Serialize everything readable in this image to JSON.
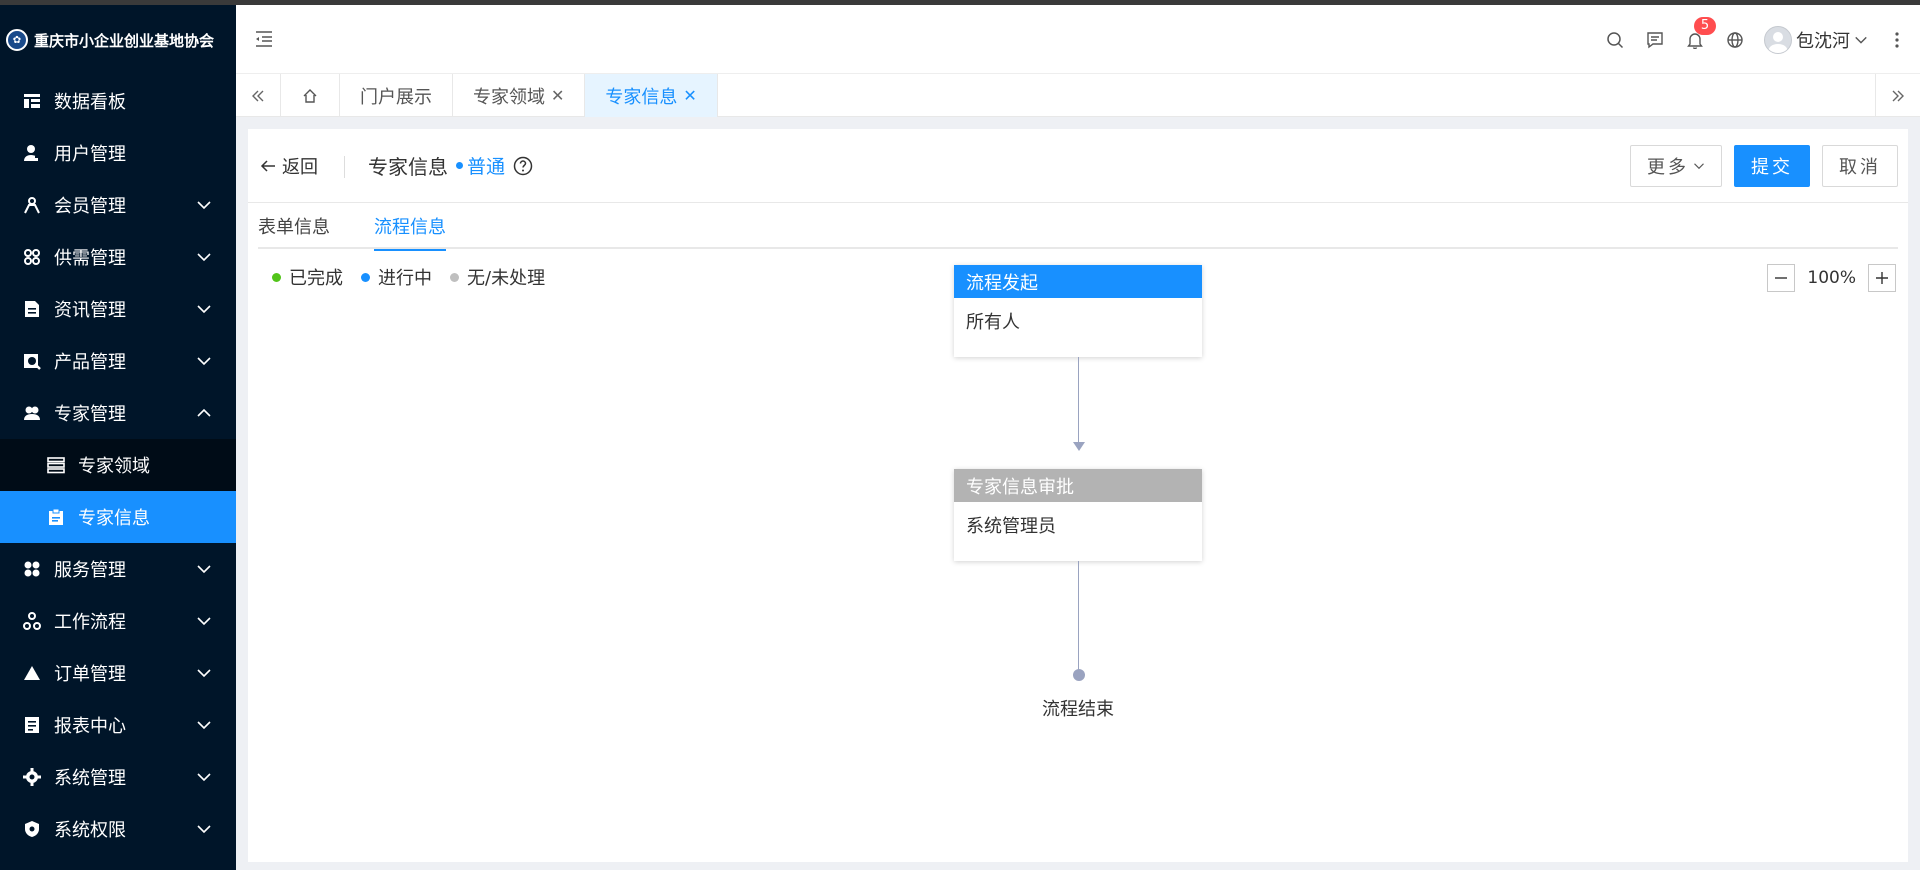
{
  "app": {
    "title": "重庆市小企业创业基地协会"
  },
  "colors": {
    "sidebar_bg": "#001529",
    "accent": "#1890ff",
    "done": "#52c41a",
    "pending": "#bfbfbf",
    "node_gray": "#b3b3b3"
  },
  "sidebar": {
    "items": [
      {
        "label": "数据看板",
        "icon": "dashboard-icon",
        "expandable": false
      },
      {
        "label": "用户管理",
        "icon": "user-icon",
        "expandable": false
      },
      {
        "label": "会员管理",
        "icon": "members-icon",
        "expandable": true
      },
      {
        "label": "供需管理",
        "icon": "grid-icon",
        "expandable": true
      },
      {
        "label": "资讯管理",
        "icon": "document-icon",
        "expandable": true
      },
      {
        "label": "产品管理",
        "icon": "product-icon",
        "expandable": true
      },
      {
        "label": "专家管理",
        "icon": "expert-icon",
        "expandable": true,
        "expanded": true,
        "children": [
          {
            "label": "专家领域",
            "icon": "list-icon"
          },
          {
            "label": "专家信息",
            "icon": "clipboard-icon",
            "active": true
          }
        ]
      },
      {
        "label": "服务管理",
        "icon": "apps-icon",
        "expandable": true
      },
      {
        "label": "工作流程",
        "icon": "workflow-icon",
        "expandable": true
      },
      {
        "label": "订单管理",
        "icon": "triangle-icon",
        "expandable": true
      },
      {
        "label": "报表中心",
        "icon": "report-icon",
        "expandable": true
      },
      {
        "label": "系统管理",
        "icon": "settings-icon",
        "expandable": true
      },
      {
        "label": "系统权限",
        "icon": "shield-icon",
        "expandable": true
      }
    ]
  },
  "header": {
    "notifications": "5",
    "user_name": "包沈河"
  },
  "tabs": [
    {
      "label": "门户展示",
      "closable": false
    },
    {
      "label": "专家领域",
      "closable": true
    },
    {
      "label": "专家信息",
      "closable": true,
      "active": true
    }
  ],
  "page": {
    "back_label": "返回",
    "title": "专家信息",
    "type_label": "普通",
    "actions": {
      "more": "更多",
      "submit": "提交",
      "cancel": "取消"
    },
    "subtabs": [
      "表单信息",
      "流程信息"
    ],
    "active_subtab": 1
  },
  "legend": [
    {
      "label": "已完成",
      "color": "#52c41a"
    },
    {
      "label": "进行中",
      "color": "#1890ff"
    },
    {
      "label": "无/未处理",
      "color": "#bfbfbf"
    }
  ],
  "zoom": {
    "level": "100%"
  },
  "flow": {
    "nodes": [
      {
        "title": "流程发起",
        "assignee": "所有人",
        "status": "in-progress"
      },
      {
        "title": "专家信息审批",
        "assignee": "系统管理员",
        "status": "pending"
      }
    ],
    "end_label": "流程结束"
  }
}
